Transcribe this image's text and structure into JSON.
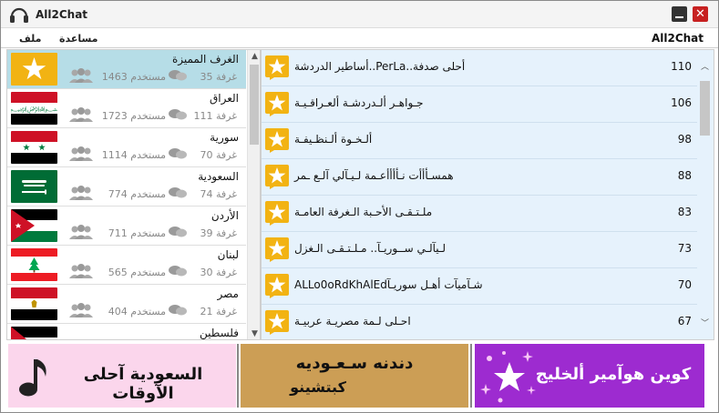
{
  "window": {
    "title": "All2Chat"
  },
  "menu": {
    "file": "ملف",
    "help": "مساعدة",
    "brand": "All2Chat"
  },
  "countries": [
    {
      "name": "الغرف المميزة",
      "users": "مستخدم 1463",
      "rooms": "غرفة 35",
      "flag": "featured-star"
    },
    {
      "name": "العراق",
      "users": "مستخدم 1723",
      "rooms": "غرفة 111",
      "flag": "iraq-flag"
    },
    {
      "name": "سورية",
      "users": "مستخدم 1114",
      "rooms": "غرفة 70",
      "flag": "syria-flag"
    },
    {
      "name": "السعودية",
      "users": "مستخدم 774",
      "rooms": "غرفة 74",
      "flag": "saudi-flag"
    },
    {
      "name": "الأردن",
      "users": "مستخدم 711",
      "rooms": "غرفة 39",
      "flag": "jordan-flag"
    },
    {
      "name": "لبنان",
      "users": "مستخدم 565",
      "rooms": "غرفة 30",
      "flag": "lebanon-flag"
    },
    {
      "name": "مصر",
      "users": "مستخدم 404",
      "rooms": "غرفة 21",
      "flag": "egypt-flag"
    },
    {
      "name": "فلسطين",
      "users": "",
      "rooms": "",
      "flag": "palestine-flag"
    }
  ],
  "rooms": [
    {
      "name": "أحلى صدفة..PerLa..أساطير الدردشة",
      "count": "110"
    },
    {
      "name": "جـواهـر ألـدردشـة ألعـراقـيـة",
      "count": "106"
    },
    {
      "name": "ألـخـوة ألـنظـيفـة",
      "count": "98"
    },
    {
      "name": "همسـأأأت نـأأأأعـمة لـيـآلي آلـع ـمر",
      "count": "88"
    },
    {
      "name": "ملـتـقـى الأحـبة الـغرفة العامـة",
      "count": "83"
    },
    {
      "name": "لـيآلـي ســوريـآ.. مـلـتـقـى الـغزل",
      "count": "73"
    },
    {
      "name": "شـآميآت أهـل سوريـآALLo0oRdKhAlEd",
      "count": "70"
    },
    {
      "name": "احـلى لـمة مصريـة عربيـة",
      "count": "67"
    }
  ],
  "banners": {
    "b1": "السعودية آحلى الآوقات",
    "b2_line1": "دندنه سـعـوديه",
    "b2_line2": "كبتشينو",
    "b3": "كوين هوآمير ألخليج"
  },
  "colors": {
    "featured_row": "#b6dde7",
    "rooms_bg": "#e6f2fc",
    "star_gold": "#f2b313",
    "banner_pink": "#fbd6ec",
    "banner_gold": "#cc9e55",
    "banner_purple": "#9d2bd0",
    "close_red": "#c72121"
  }
}
